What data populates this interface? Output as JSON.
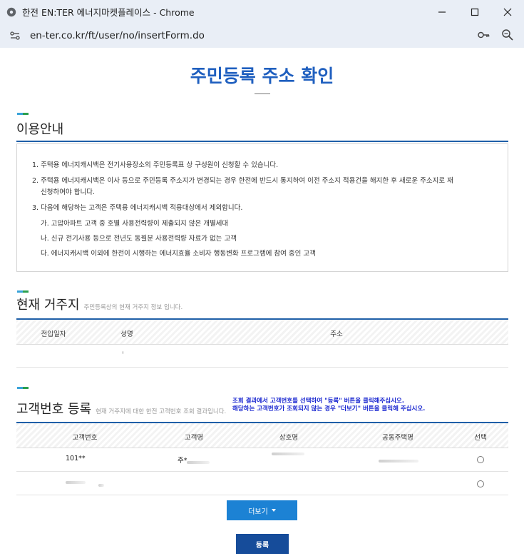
{
  "browser": {
    "window_title": "한전 EN:TER 에너지마켓플레이스 - Chrome",
    "url": "en-ter.co.kr/ft/user/no/insertForm.do"
  },
  "page": {
    "title": "주민등록 주소 확인"
  },
  "guide": {
    "title": "이용안내",
    "items": [
      "1. 주택용 에너지캐시백은 전기사용장소의 주민등록표 상 구성원이 신청할 수 있습니다.",
      "2. 주택용 에너지캐시백은 이사 등으로 주민등록 주소지가 변경되는 경우 한전에 반드시 통지하여 이전 주소지 적용건을 해지한 후 새로운 주소지로 재",
      "신청하여야 합니다.",
      "3. 다음에 해당하는 고객은 주택용 에너지캐시백 적용대상에서 제외합니다.",
      "가. 고압아파트 고객 중 호별 사용전력량이 제출되지 않은 개별세대",
      "나. 신규 전기사용 등으로 전년도 동월분 사용전력량 자료가 없는 고객",
      "다. 에너지캐시백 이외에 한전이 시행하는 에너지효율 소비자 행동변화 프로그램에 참여 중인 고객"
    ]
  },
  "residence": {
    "title": "현재 거주지",
    "desc": "주민등록상의 현재 거주지 정보 입니다.",
    "columns": [
      "전입일자",
      "성명",
      "주소"
    ]
  },
  "customer": {
    "title": "고객번호 등록",
    "desc": "현재 거주지에 대한 한전 고객번호 조회 결과입니다.",
    "notice": [
      "조회 결과에서 고객번호를 선택하여 \"등록\" 버튼을 클릭해주십시오.",
      "해당하는 고객번호가 조회되지 않는 경우 \"더보기\" 버튼을 클릭해 주십시오."
    ],
    "columns": [
      "고객번호",
      "고객명",
      "상호명",
      "공동주택명",
      "선택"
    ],
    "rows": [
      {
        "number": "101**",
        "name": "주*"
      },
      {
        "number": "",
        "name": ""
      }
    ]
  },
  "buttons": {
    "more": "더보기",
    "register": "등록"
  },
  "colors": {
    "title_blue": "#1f5fbf",
    "notice_blue": "#1a27d0",
    "more_button": "#1c82d4",
    "register_button": "#164c9a"
  }
}
